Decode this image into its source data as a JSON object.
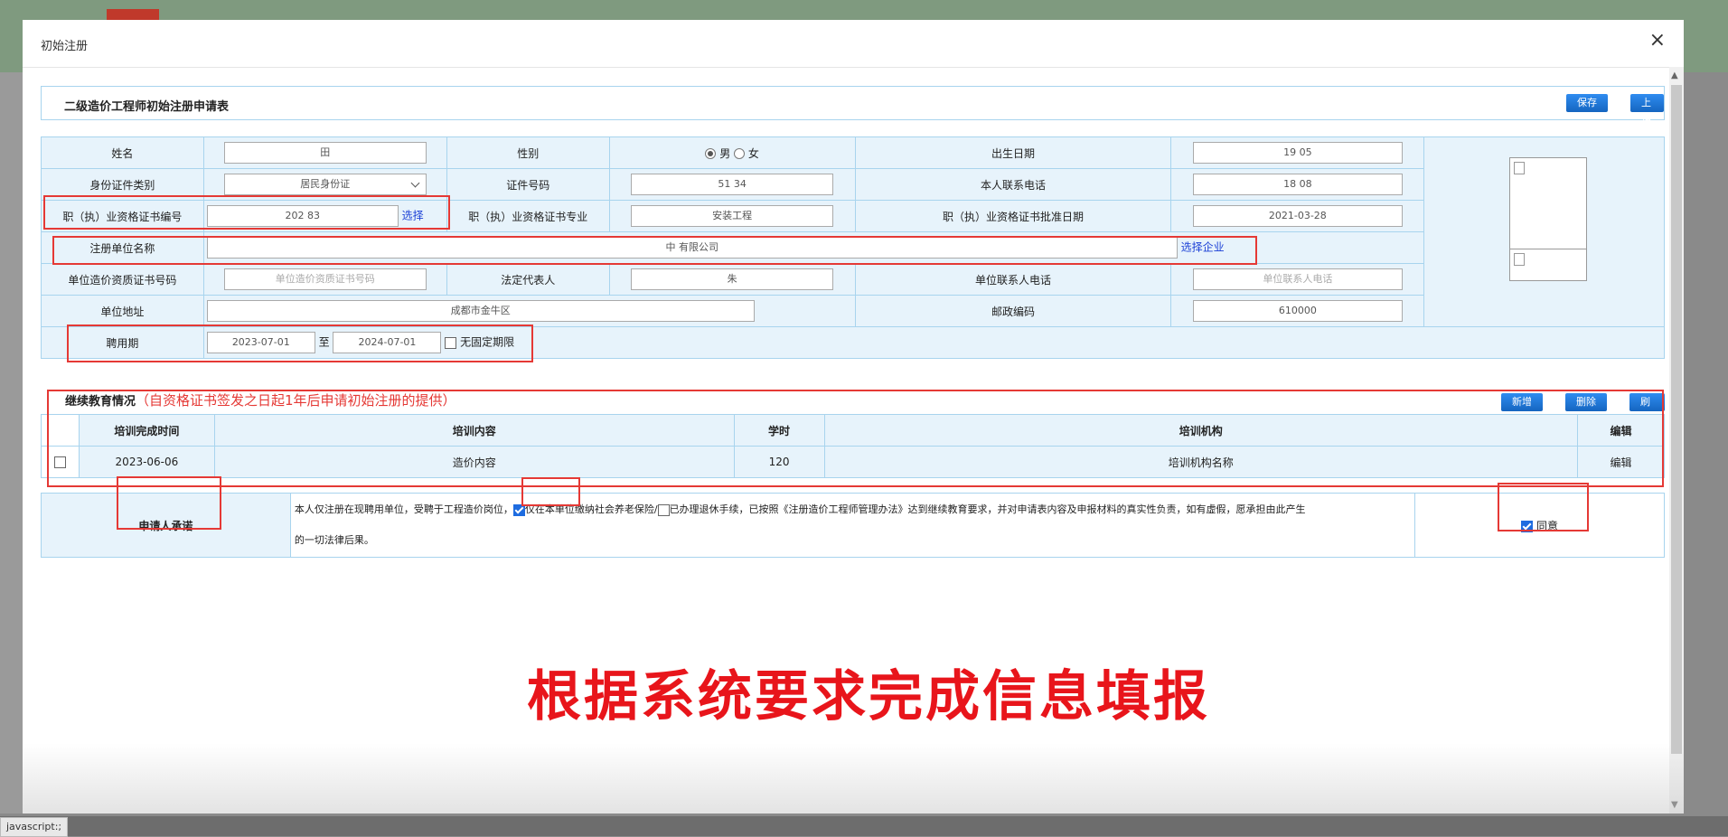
{
  "status_bar": "javascript:;",
  "modal": {
    "title": "初始注册",
    "close": "×"
  },
  "form": {
    "title": "二级造价工程师初始注册申请表",
    "save": "保存",
    "submit": "上报企业"
  },
  "fields": {
    "name_label": "姓名",
    "name_value": "田",
    "gender_label": "性别",
    "gender_male": "男",
    "gender_female": "女",
    "birth_label": "出生日期",
    "birth_value": "19            05",
    "id_type_label": "身份证件类别",
    "id_type_value": "居民身份证",
    "id_no_label": "证件号码",
    "id_no_value": "51                              34",
    "phone_label": "本人联系电话",
    "phone_value": "18              08",
    "cert_no_label": "职（执）业资格证书编号",
    "cert_no_value": "202                                  83",
    "cert_select": "选择",
    "cert_major_label": "职（执）业资格证书专业",
    "cert_major_value": "安装工程",
    "cert_date_label": "职（执）业资格证书批准日期",
    "cert_date_value": "2021-03-28",
    "unit_name_label": "注册单位名称",
    "unit_name_value": "中                                    有限公司",
    "unit_select": "选择企业",
    "unit_qual_label": "单位造价资质证书号码",
    "unit_qual_placeholder": "单位造价资质证书号码",
    "legal_rep_label": "法定代表人",
    "legal_rep_value": "朱",
    "unit_contact_label": "单位联系人电话",
    "unit_contact_placeholder": "单位联系人电话",
    "unit_addr_label": "单位地址",
    "unit_addr_value": "成都市金牛区",
    "postcode_label": "邮政编码",
    "postcode_value": "610000",
    "employ_label": "聘用期",
    "employ_start": "2023-07-01",
    "employ_to": "至",
    "employ_end": "2024-07-01",
    "no_fixed": "无固定期限"
  },
  "education": {
    "title": "继续教育情况",
    "note": "（自资格证书签发之日起1年后申请初始注册的提供）",
    "add": "新增",
    "delete": "删除",
    "refresh": "刷新",
    "headers": [
      "培训完成时间",
      "培训内容",
      "学时",
      "培训机构",
      "编辑"
    ],
    "rows": [
      {
        "date": "2023-06-06",
        "content": "造价内容",
        "hours": "120",
        "org": "培训机构名称",
        "edit": "编辑"
      }
    ]
  },
  "commitment": {
    "label": "申请人承诺",
    "text1": "本人仅注册在现聘用单位，受聘于工程造价岗位，",
    "opt1": "仅在本单位缴纳社会养老保险/",
    "opt2": "已办理退休手续，已按照《注册造价工程师管理办法》达到继续教育要求，并对申请表内容及申报材料的真实性负责，如有虚假，愿承担由此产生",
    "text2": "的一切法律后果。",
    "agree": "同意"
  },
  "overlay_caption": "根据系统要求完成信息填报",
  "colors": {
    "accent_blue": "#1565c0",
    "cell_bg": "#e7f3fb",
    "border": "#a8d4ee",
    "highlight_red": "#e53935"
  }
}
